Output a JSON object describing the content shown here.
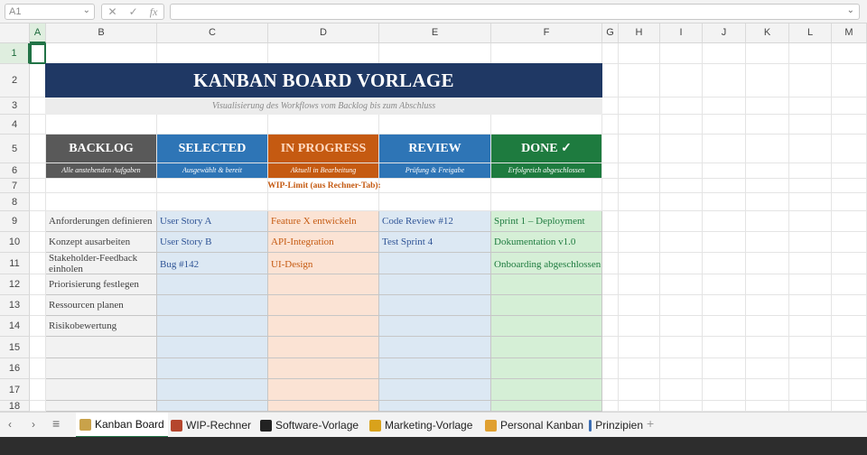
{
  "formula_bar": {
    "name_box": "A1",
    "fx": "fx"
  },
  "columns": [
    "A",
    "B",
    "C",
    "D",
    "E",
    "F",
    "G",
    "H",
    "I",
    "J",
    "K",
    "L",
    "M"
  ],
  "rows": [
    "1",
    "2",
    "3",
    "4",
    "5",
    "6",
    "7",
    "8",
    "9",
    "10",
    "11",
    "12",
    "13",
    "14",
    "15",
    "16",
    "17",
    "18"
  ],
  "board": {
    "title": "KANBAN BOARD VORLAGE",
    "subtitle": "Visualisierung des Workflows vom Backlog bis zum Abschluss",
    "wip_label": "WIP-Limit (aus Rechner-Tab):",
    "lanes": [
      {
        "name": "BACKLOG",
        "desc": "Alle anstehenden Aufgaben",
        "color": "#595959",
        "cell_bg": "#f2f2f2",
        "text_color": "#404040",
        "items": [
          "Anforderungen definieren",
          "Konzept ausarbeiten",
          "Stakeholder-Feedback einholen",
          "Priorisierung festlegen",
          "Ressourcen planen",
          "Risikobewertung",
          "",
          "",
          "",
          ""
        ]
      },
      {
        "name": "SELECTED",
        "desc": "Ausgewählt & bereit",
        "color": "#2e75b6",
        "cell_bg": "#dce8f3",
        "text_color": "#2f5496",
        "items": [
          "User Story A",
          "User Story B",
          "Bug #142",
          "",
          "",
          "",
          "",
          "",
          "",
          ""
        ]
      },
      {
        "name": "IN PROGRESS",
        "desc": "Aktuell in Bearbeitung",
        "color": "#c55a11",
        "cell_bg": "#fbe3d4",
        "text_color": "#c55a11",
        "items": [
          "Feature X entwickeln",
          "API-Integration",
          "UI-Design",
          "",
          "",
          "",
          "",
          "",
          "",
          ""
        ]
      },
      {
        "name": "REVIEW",
        "desc": "Prüfung & Freigabe",
        "color": "#2e75b6",
        "cell_bg": "#dce8f3",
        "text_color": "#2f5496",
        "items": [
          "Code Review #12",
          "Test Sprint 4",
          "",
          "",
          "",
          "",
          "",
          "",
          "",
          ""
        ]
      },
      {
        "name": "DONE ✓",
        "desc": "Erfolgreich abgeschlossen",
        "color": "#1e7b3f",
        "cell_bg": "#d5efd6",
        "text_color": "#1e7b3f",
        "items": [
          "Sprint 1 – Deployment",
          "Dokumentation v1.0",
          "Onboarding abgeschlossen",
          "",
          "",
          "",
          "",
          "",
          "",
          ""
        ]
      }
    ]
  },
  "tabs": [
    {
      "label": "Kanban Board",
      "icon": "clipboard-icon",
      "icon_color": "#c9a24a",
      "active": true
    },
    {
      "label": "WIP-Rechner",
      "icon": "abacus-icon",
      "icon_color": "#b5462d",
      "active": false
    },
    {
      "label": "Software-Vorlage",
      "icon": "monitor-icon",
      "icon_color": "#222222",
      "active": false
    },
    {
      "label": "Marketing-Vorlage",
      "icon": "megaphone-icon",
      "icon_color": "#d9a21b",
      "active": false
    },
    {
      "label": "Personal Kanban",
      "icon": "person-icon",
      "icon_color": "#e0a030",
      "active": false
    },
    {
      "label": "Prinzipien",
      "icon": "book-icon",
      "icon_color": "#3b6db3",
      "active": false
    }
  ],
  "add_sheet": "+"
}
